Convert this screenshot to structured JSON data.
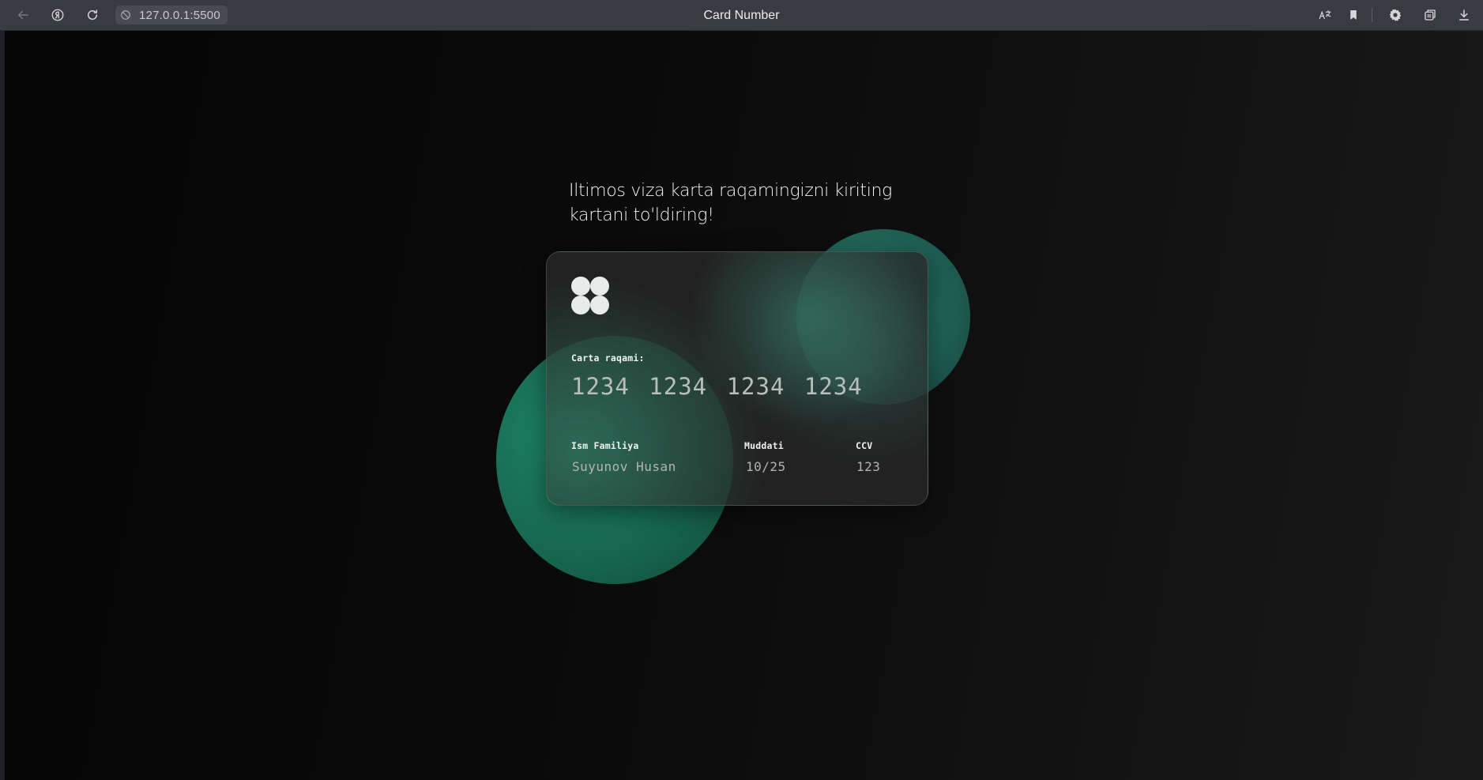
{
  "browser": {
    "url": "127.0.0.1:5500",
    "tab_title": "Card Number",
    "icons": {
      "back": "arrow-left-icon",
      "yandex": "yandex-icon",
      "reload": "reload-icon",
      "site_info": "site-info-icon",
      "translate": "translate-icon",
      "bookmark": "bookmark-icon",
      "settings": "gear-icon",
      "tabs": "tabs-icon",
      "download": "download-icon"
    }
  },
  "page": {
    "heading_line1": "Iltimos viza karta raqamingizni kiriting",
    "heading_line2": "kartani to'ldiring!",
    "colors": {
      "accent_green": "#1f8a68",
      "accent_teal": "#2a7966",
      "background": "#0b0b0b"
    }
  },
  "card": {
    "logo_icon": "four-circles-logo-icon",
    "number_label": "Carta raqami:",
    "number_value": "1234 1234 1234 1234",
    "name_label": "Ism Familiya",
    "name_value": "Suyunov Husan",
    "expiry_label": "Muddati",
    "expiry_value": "10/25",
    "ccv_label": "CCV",
    "ccv_value": "123"
  }
}
